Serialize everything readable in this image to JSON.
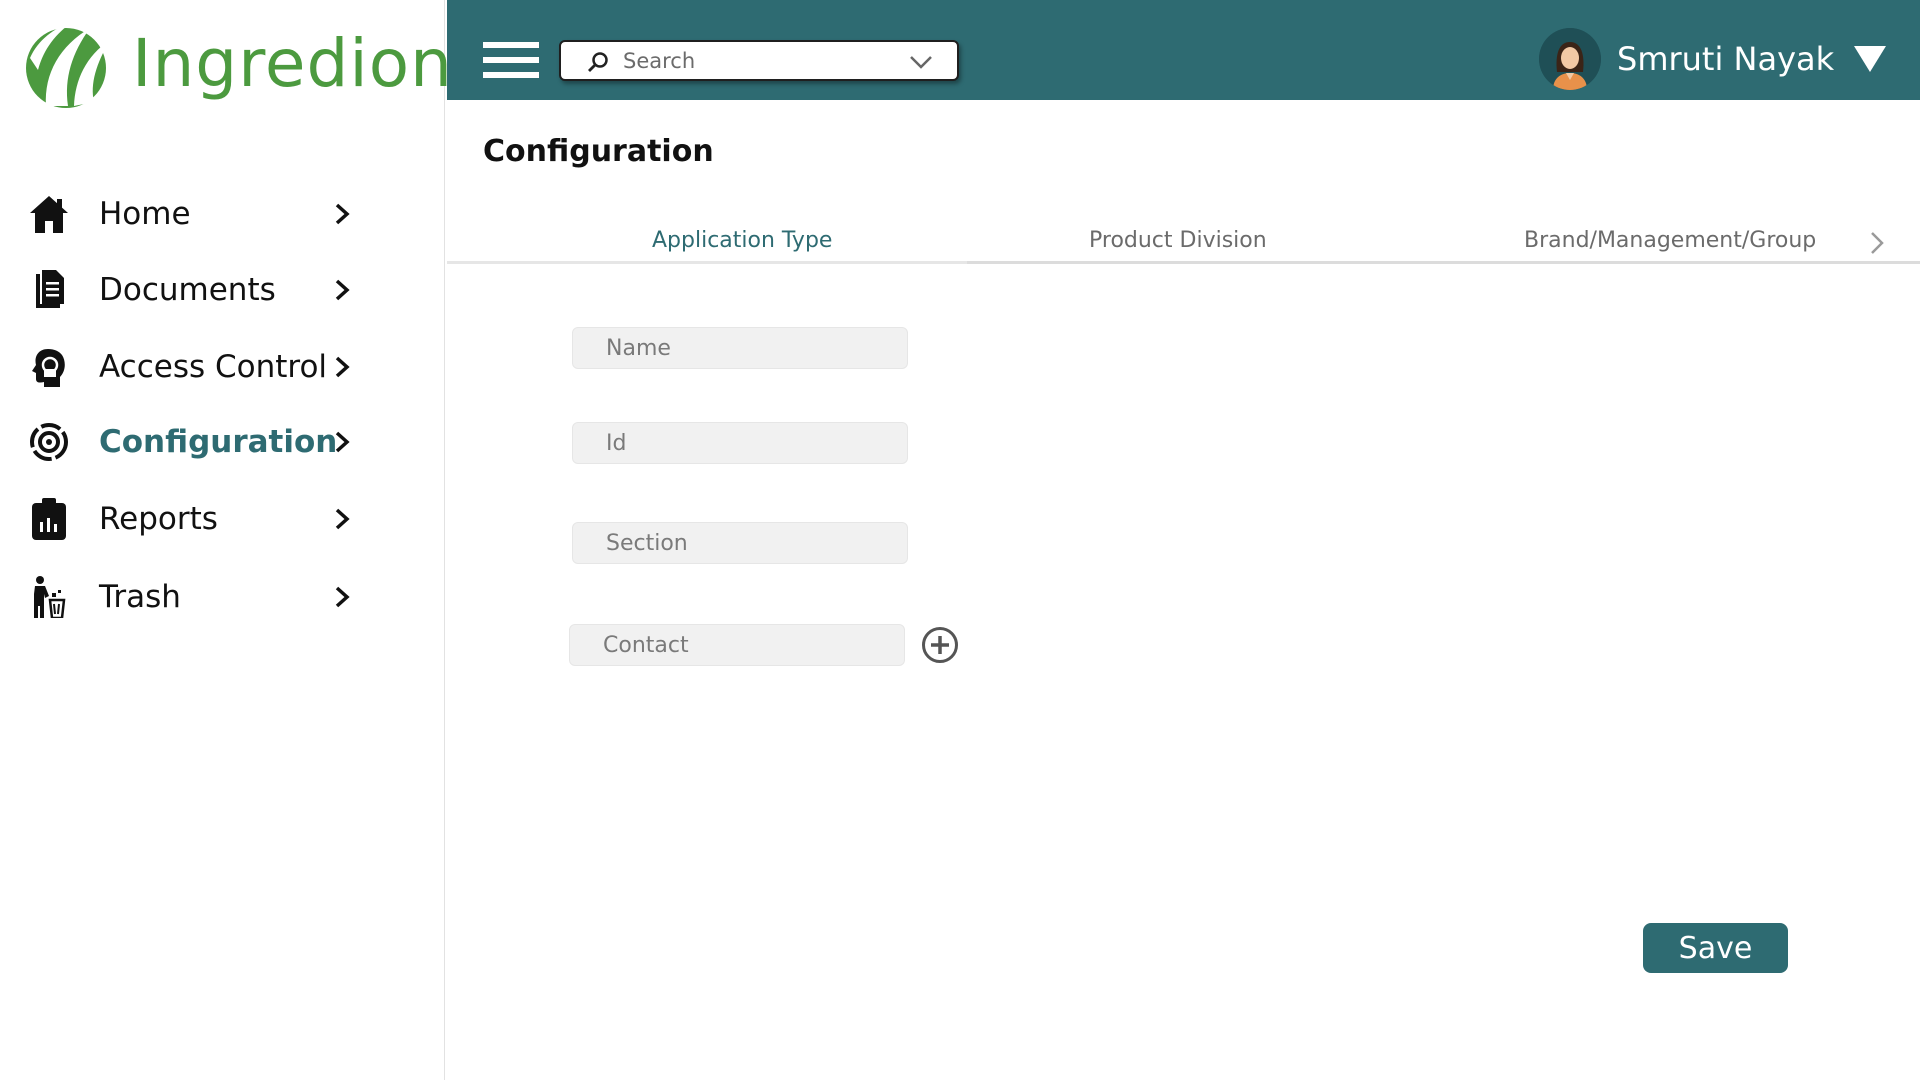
{
  "app": {
    "brand": "Ingredion"
  },
  "header": {
    "search_placeholder": "Search",
    "user_name": "Smruti Nayak"
  },
  "sidebar": {
    "items": [
      {
        "label": "Home",
        "icon": "home-icon",
        "active": false
      },
      {
        "label": "Documents",
        "icon": "documents-icon",
        "active": false
      },
      {
        "label": "Access Control",
        "icon": "access-control-icon",
        "active": false
      },
      {
        "label": "Configuration",
        "icon": "configuration-icon",
        "active": true
      },
      {
        "label": "Reports",
        "icon": "reports-icon",
        "active": false
      },
      {
        "label": "Trash",
        "icon": "trash-icon",
        "active": false
      }
    ]
  },
  "main": {
    "title": "Configuration",
    "tabs": [
      {
        "label": "Application Type",
        "active": true
      },
      {
        "label": "Product Division",
        "active": false
      },
      {
        "label": "Brand/Management/Group",
        "active": false
      }
    ],
    "form": {
      "name_placeholder": "Name",
      "id_placeholder": "Id",
      "section_placeholder": "Section",
      "contact_placeholder": "Contact"
    },
    "save_label": "Save"
  },
  "colors": {
    "brand_green": "#4c9a3f",
    "header_teal": "#2e6b72",
    "active_text": "#2e6b72"
  }
}
